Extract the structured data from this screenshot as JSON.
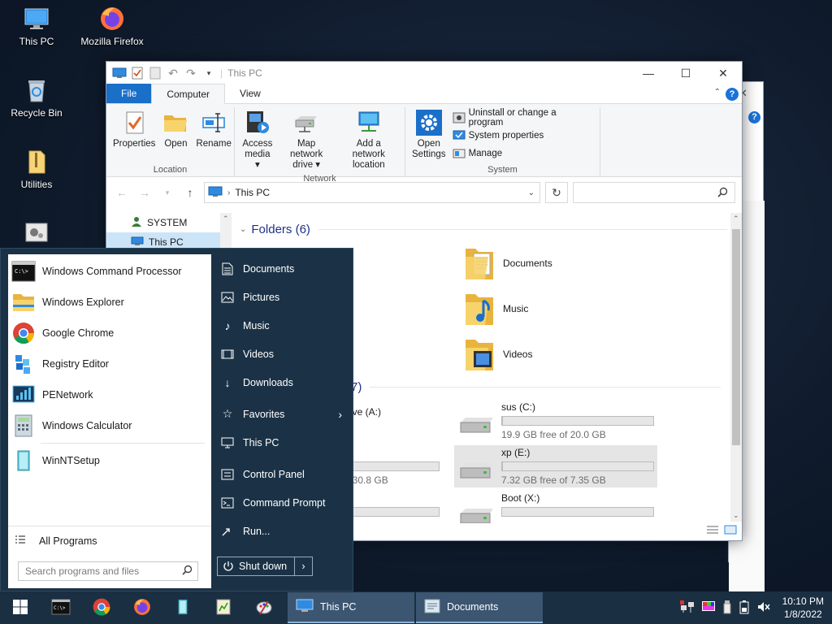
{
  "desktop": {
    "icons": [
      {
        "label": "This PC",
        "icon": "monitor-icon"
      },
      {
        "label": "Mozilla Firefox",
        "icon": "firefox-icon"
      },
      {
        "label": "Recycle Bin",
        "icon": "recycle-bin-icon"
      },
      {
        "label": "Utilities",
        "icon": "folder-zip-icon"
      }
    ]
  },
  "explorer": {
    "title": "This PC",
    "tabs": {
      "file": "File",
      "computer": "Computer",
      "view": "View"
    },
    "ribbon": {
      "location": {
        "name": "Location",
        "properties": "Properties",
        "open": "Open",
        "rename": "Rename"
      },
      "network": {
        "name": "Network",
        "access_media_1": "Access",
        "access_media_2": "media ▾",
        "map_drive_1": "Map network",
        "map_drive_2": "drive ▾",
        "add_location_1": "Add a network",
        "add_location_2": "location"
      },
      "system": {
        "name": "System",
        "open_settings_1": "Open",
        "open_settings_2": "Settings",
        "uninstall": "Uninstall or change a program",
        "system_properties": "System properties",
        "manage": "Manage"
      }
    },
    "address": {
      "path": "This PC",
      "search_placeholder": ""
    },
    "nav": [
      {
        "label": "SYSTEM"
      },
      {
        "label": "This PC"
      }
    ],
    "folders_header": "Folders (6)",
    "folders": [
      {
        "label": "Documents"
      },
      {
        "label": "Music"
      },
      {
        "label": "Videos"
      }
    ],
    "devices_header_count": "(7)",
    "drives": [
      {
        "name": "rive (A:)",
        "free": "",
        "used_fraction": 0
      },
      {
        "name": "sus (C:)",
        "free": "19.9 GB free of 20.0 GB",
        "used_fraction": 0.005
      },
      {
        "name": "",
        "free": "f 30.8 GB",
        "used_fraction": 0
      },
      {
        "name": "xp (E:)",
        "free": "7.32 GB free of 7.35 GB",
        "used_fraction": 0.004
      },
      {
        "name": "",
        "free": "",
        "used_fraction": 0
      },
      {
        "name": "Boot (X:)",
        "free": "",
        "used_fraction": 0
      }
    ]
  },
  "startmenu": {
    "programs": [
      {
        "label": "Windows Command Processor",
        "icon": "cmd-icon"
      },
      {
        "label": "Windows Explorer",
        "icon": "explorer-folder-icon"
      },
      {
        "label": "Google Chrome",
        "icon": "chrome-icon"
      },
      {
        "label": "Registry Editor",
        "icon": "registry-icon"
      },
      {
        "label": "PENetwork",
        "icon": "network-icon"
      },
      {
        "label": "Windows Calculator",
        "icon": "calculator-icon"
      },
      {
        "label": "WinNTSetup",
        "icon": "winntsetup-icon"
      }
    ],
    "all_programs": "All Programs",
    "search_placeholder": "Search programs and files",
    "places": [
      {
        "label": "Documents",
        "icon": "document-icon"
      },
      {
        "label": "Pictures",
        "icon": "picture-icon"
      },
      {
        "label": "Music",
        "icon": "music-note-icon"
      },
      {
        "label": "Videos",
        "icon": "video-icon"
      },
      {
        "label": "Downloads",
        "icon": "download-icon"
      },
      {
        "label": "Favorites",
        "icon": "star-icon"
      },
      {
        "label": "This PC",
        "icon": "monitor-icon"
      },
      {
        "label": "Control Panel",
        "icon": "control-panel-icon"
      },
      {
        "label": "Command Prompt",
        "icon": "cmd-icon"
      },
      {
        "label": "Run...",
        "icon": "run-icon"
      }
    ],
    "shutdown": "Shut down"
  },
  "taskbar": {
    "windows": [
      {
        "label": "This PC"
      },
      {
        "label": "Documents"
      }
    ],
    "time": "10:10 PM",
    "date": "1/8/2022"
  }
}
